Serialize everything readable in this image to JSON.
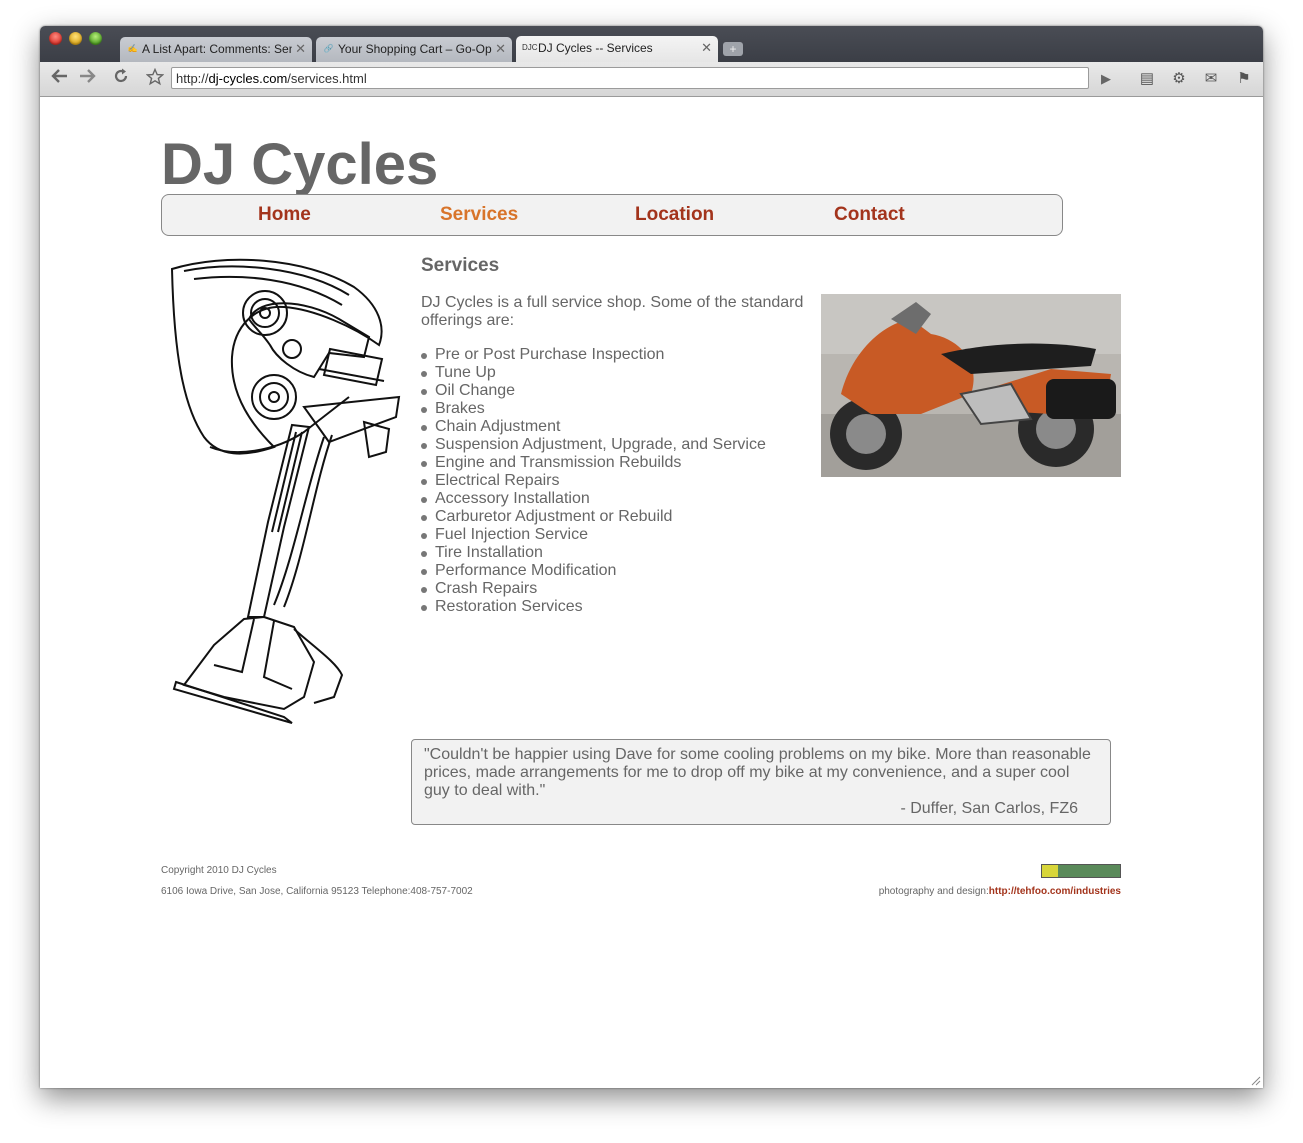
{
  "browser": {
    "tabs": [
      {
        "favicon": "✍",
        "title": "A List Apart: Comments: Sen"
      },
      {
        "favicon": "🔗",
        "title": "Your Shopping Cart – Go-Op"
      },
      {
        "favicon": "DJC",
        "title": "DJ Cycles -- Services"
      }
    ],
    "url_scheme": "http://",
    "url_domain": "dj-cycles.com",
    "url_path": "/services.html",
    "icons": {
      "back": "back-arrow-icon",
      "forward": "forward-arrow-icon",
      "reload": "reload-icon",
      "bookmark": "star-icon",
      "go": "play-icon"
    }
  },
  "site": {
    "title": "DJ Cycles",
    "nav": [
      "Home",
      "Services",
      "Location",
      "Contact"
    ],
    "active_nav": "Services"
  },
  "main": {
    "heading": "Services",
    "intro": "DJ Cycles is a full service shop. Some of the standard offerings are:",
    "services": [
      "Pre or Post Purchase Inspection",
      "Tune Up",
      "Oil Change",
      "Brakes",
      "Chain Adjustment",
      "Suspension Adjustment, Upgrade, and Service",
      "Engine and Transmission Rebuilds",
      "Electrical Repairs",
      "Accessory Installation",
      "Carburetor Adjustment or Rebuild",
      "Fuel Injection Service",
      "Tire Installation",
      "Performance Modification",
      "Crash Repairs",
      "Restoration Services"
    ]
  },
  "testimonial": {
    "text": "\"Couldn't be happier using Dave for some cooling problems on my bike. More than reasonable prices, made arrangements for me to drop off my bike at my convenience, and a super cool guy to deal with.\"",
    "attribution": "- Duffer, San Carlos, FZ6"
  },
  "footer": {
    "copyright": "Copyright 2010 DJ Cycles",
    "address": "6106 Iowa Drive, San Jose, California 95123 Telephone:408-757-7002",
    "credit_label": "photography and design:",
    "credit_link": "http://tehfoo.com/industries"
  },
  "colors": {
    "nav_link": "#a3341c",
    "nav_active": "#d8742a",
    "text": "#666666",
    "badge_left": "#d8d63a",
    "badge_right": "#5a8a5a",
    "motorcycle_body": "#c85a25"
  }
}
